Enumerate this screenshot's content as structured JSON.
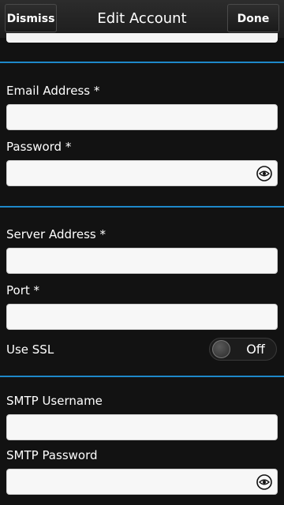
{
  "titlebar": {
    "dismiss_label": "Dismiss",
    "title": "Edit Account",
    "done_label": "Done"
  },
  "form": {
    "email_label": "Email Address *",
    "email_value": "",
    "password_label": "Password *",
    "password_value": "",
    "server_label": "Server Address *",
    "server_value": "",
    "port_label": "Port *",
    "port_value": "",
    "ssl_label": "Use SSL",
    "ssl_toggle": "Off",
    "smtp_username_label": "SMTP Username",
    "smtp_username_value": "",
    "smtp_password_label": "SMTP Password",
    "smtp_password_value": ""
  },
  "icons": {
    "password_reveal": "eye-icon",
    "smtp_password_reveal": "eye-icon"
  },
  "colors": {
    "divider": "#1e88c9",
    "background": "#121212"
  }
}
